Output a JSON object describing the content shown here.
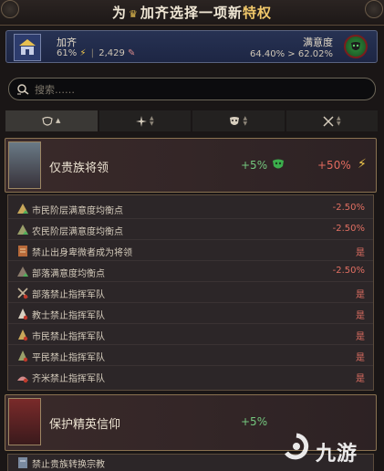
{
  "header": {
    "title_prefix": "为",
    "title_estate": "加齐",
    "title_mid": "选择一项新",
    "title_suffix": "特权"
  },
  "estate": {
    "name": "加齐",
    "influence": "61%",
    "land": "2,429",
    "satisfaction_label": "满意度",
    "satisfaction_values": "64.40% > 62.02%"
  },
  "search": {
    "placeholder": "搜索……"
  },
  "privileges": [
    {
      "name": "仅贵族将领",
      "satisfaction_gain": "+5%",
      "influence_change": "+50%",
      "effects": [
        {
          "label": "市民阶层满意度均衡点",
          "value": "-2.50%",
          "icon": "tier-up-icon"
        },
        {
          "label": "农民阶层满意度均衡点",
          "value": "-2.50%",
          "icon": "tier-up-icon"
        },
        {
          "label": "禁止出身卑微者成为将领",
          "value": "是",
          "icon": "scroll-icon"
        },
        {
          "label": "部落满意度均衡点",
          "value": "-2.50%",
          "icon": "tier-up-icon"
        },
        {
          "label": "部落禁止指挥军队",
          "value": "是",
          "icon": "crossed-swords-icon"
        },
        {
          "label": "教士禁止指挥军队",
          "value": "是",
          "icon": "crossed-swords-icon"
        },
        {
          "label": "市民禁止指挥军队",
          "value": "是",
          "icon": "crossed-swords-icon"
        },
        {
          "label": "平民禁止指挥军队",
          "value": "是",
          "icon": "crossed-swords-icon"
        },
        {
          "label": "齐米禁止指挥军队",
          "value": "是",
          "icon": "crossed-swords-icon"
        }
      ]
    },
    {
      "name": "保护精英信仰",
      "satisfaction_gain": "+5%",
      "effects": [
        {
          "label": "禁止贵族转换宗教",
          "value": "",
          "icon": "scroll-icon"
        }
      ]
    }
  ],
  "watermark": "九游",
  "colors": {
    "positive": "#74c77e",
    "negative": "#e06a5e",
    "accent_gold": "#f2c94c",
    "estate_blue": "#273253"
  }
}
